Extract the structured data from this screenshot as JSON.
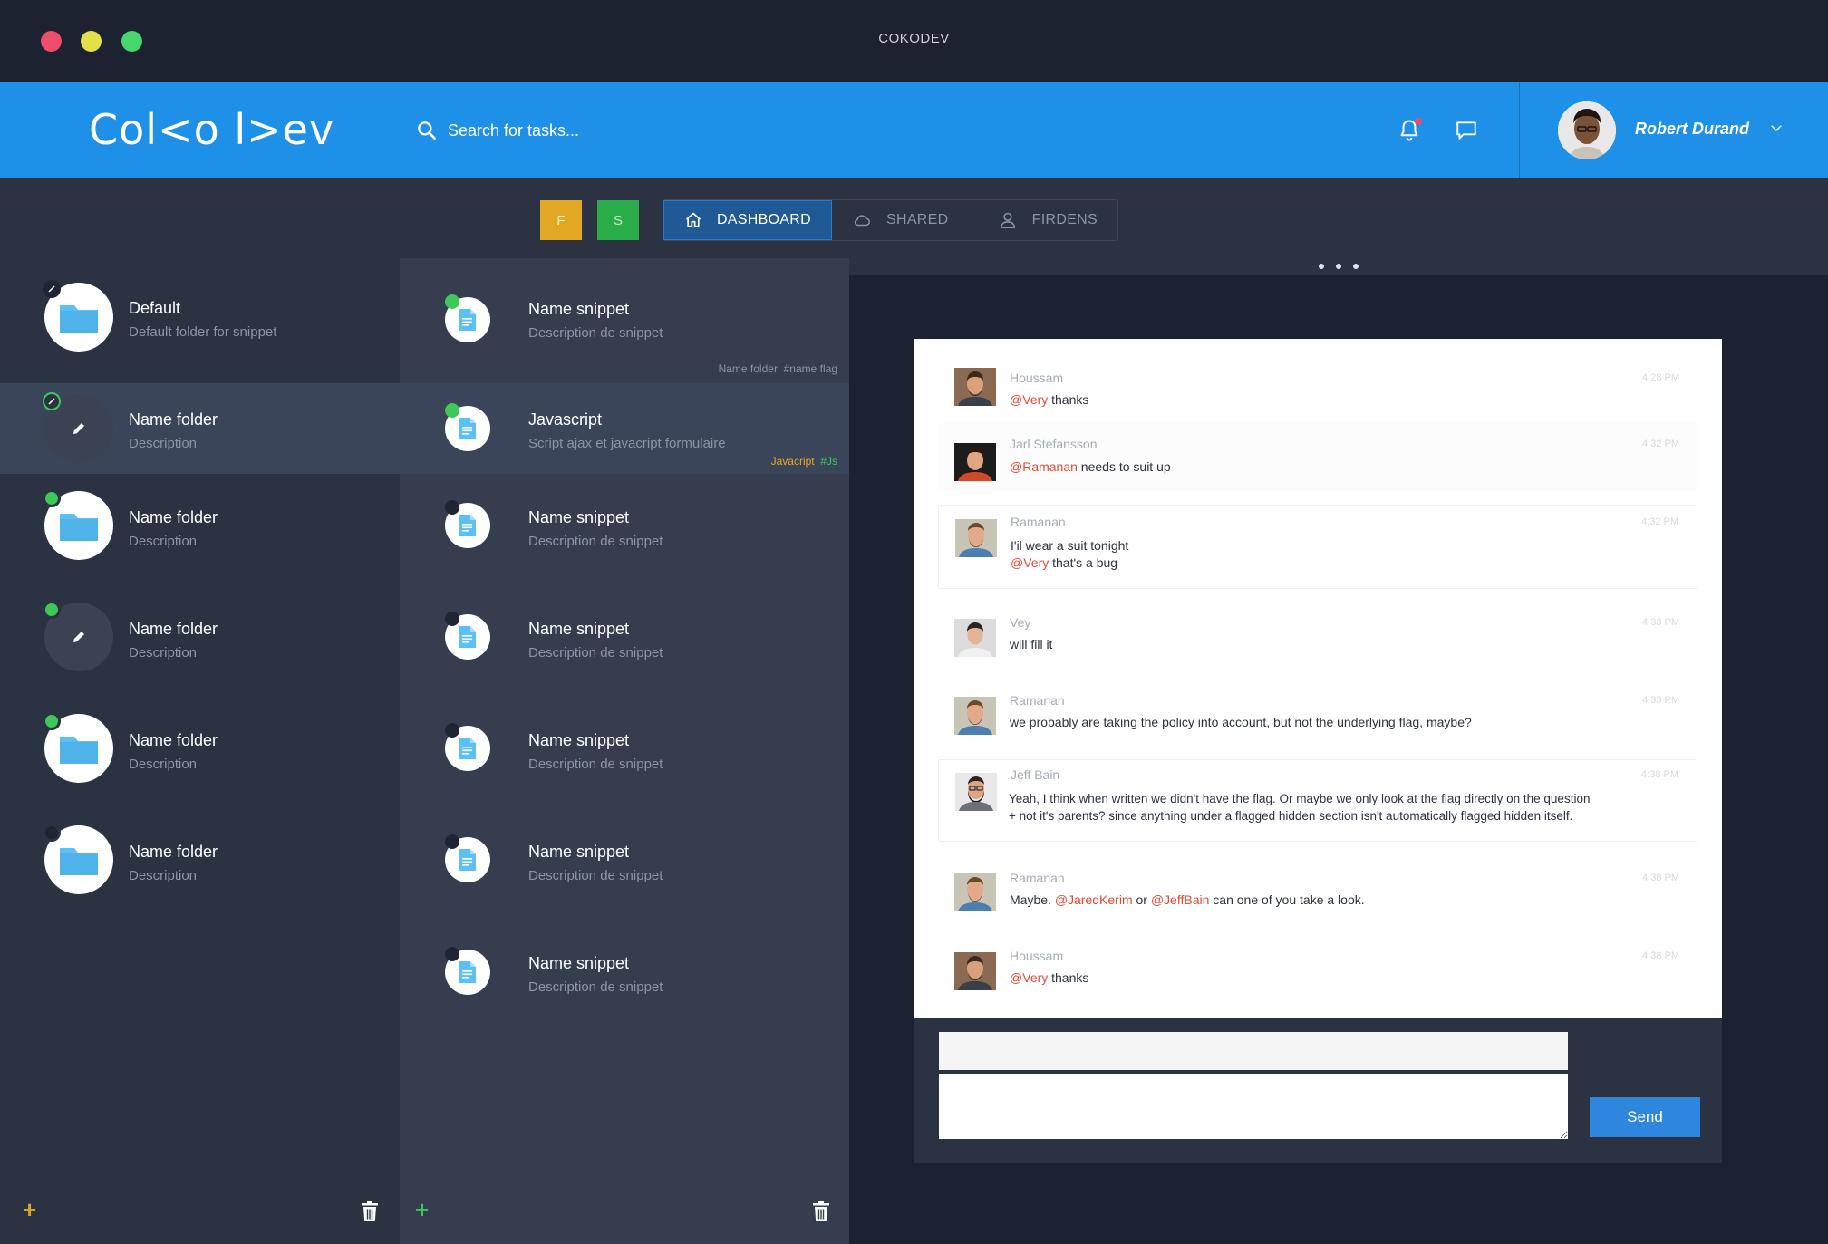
{
  "window": {
    "title": "COKODEV"
  },
  "header": {
    "logo": "Col<o l>ev",
    "search_placeholder": "Search for tasks...",
    "user_name": "Robert Durand"
  },
  "subnav": {
    "square_buttons": [
      "F",
      "S"
    ],
    "tabs": [
      {
        "label": "DASHBOARD",
        "icon": "home-icon",
        "active": true
      },
      {
        "label": "SHARED",
        "icon": "cloud-icon",
        "active": false
      },
      {
        "label": "FIRDENS",
        "icon": "user-icon",
        "active": false
      }
    ]
  },
  "folders": [
    {
      "title": "Default",
      "desc": "Default folder for snippet",
      "status": "dark-check",
      "icon": "folder-icon"
    },
    {
      "title": "Name folder",
      "desc": "Description",
      "status": "green-check",
      "icon": "pencil-icon",
      "selected": true
    },
    {
      "title": "Name folder",
      "desc": "Description",
      "status": "green",
      "icon": "folder-icon"
    },
    {
      "title": "Name folder",
      "desc": "Description",
      "status": "green",
      "icon": "pencil-icon"
    },
    {
      "title": "Name folder",
      "desc": "Description",
      "status": "green",
      "icon": "folder-icon"
    },
    {
      "title": "Name folder",
      "desc": "Description",
      "status": "dark",
      "icon": "folder-icon"
    }
  ],
  "snippets": [
    {
      "title": "Name snippet",
      "desc": "Description de snippet",
      "status": "green",
      "tags": {
        "folder": "Name folder",
        "flag": "#name flag"
      }
    },
    {
      "title": "Javascript",
      "desc": "Script ajax et javacript formulaire",
      "status": "green",
      "selected": true,
      "tags": {
        "folder": "Javacript",
        "flag": "#Js"
      }
    },
    {
      "title": "Name snippet",
      "desc": "Description de snippet",
      "status": "dark"
    },
    {
      "title": "Name snippet",
      "desc": "Description de snippet",
      "status": "dark"
    },
    {
      "title": "Name snippet",
      "desc": "Description de snippet",
      "status": "dark"
    },
    {
      "title": "Name snippet",
      "desc": "Description de snippet",
      "status": "dark"
    },
    {
      "title": "Name snippet",
      "desc": "Description de snippet",
      "status": "dark"
    }
  ],
  "messages": [
    {
      "name": "Houssam",
      "time": "4:28 PM",
      "parts": [
        [
          {
            "m": "@Very"
          },
          {
            "t": " thanks"
          }
        ]
      ]
    },
    {
      "name": "Jarl Stefansson",
      "time": "4:32 PM",
      "parts": [
        [
          {
            "m": "@Ramanan"
          },
          {
            "t": " needs to suit up"
          }
        ]
      ]
    },
    {
      "name": "Ramanan",
      "time": "4:32 PM",
      "parts": [
        [
          {
            "t": "I'il wear a suit tonight"
          }
        ],
        [
          {
            "m": "@Very"
          },
          {
            "t": " that's a bug"
          }
        ]
      ]
    },
    {
      "name": "Vey",
      "time": "4:33 PM",
      "parts": [
        [
          {
            "t": "will fill it"
          }
        ]
      ]
    },
    {
      "name": "Ramanan",
      "time": "4:33 PM",
      "parts": [
        [
          {
            "t": "we probably are taking the policy into account, but not the underlying flag, maybe?"
          }
        ]
      ]
    },
    {
      "name": "Jeff Bain",
      "time": "4:38 PM",
      "parts": [
        [
          {
            "t": "Yeah, I think when written we didn't have the flag. Or maybe we only look at the flag directly on the question"
          }
        ],
        [
          {
            "t": "+ not it's parents? since anything under a flagged hidden section isn't automatically flagged hidden itself."
          }
        ]
      ]
    },
    {
      "name": "Ramanan",
      "time": "4:38 PM",
      "parts": [
        [
          {
            "t": "Maybe. "
          },
          {
            "m": "@JaredKerim"
          },
          {
            "t": " or "
          },
          {
            "m": "@JeffBain"
          },
          {
            "t": " can one of you take a look."
          }
        ]
      ]
    },
    {
      "name": "Houssam",
      "time": "4:38 PM",
      "parts": [
        [
          {
            "m": "@Very"
          },
          {
            "t": " thanks"
          }
        ]
      ]
    }
  ],
  "chat_input": {
    "send_label": "Send"
  },
  "colors": {
    "accent": "#1e90e8",
    "green": "#3ec85a",
    "yellow": "#e3a823",
    "mention": "#e04a35"
  }
}
